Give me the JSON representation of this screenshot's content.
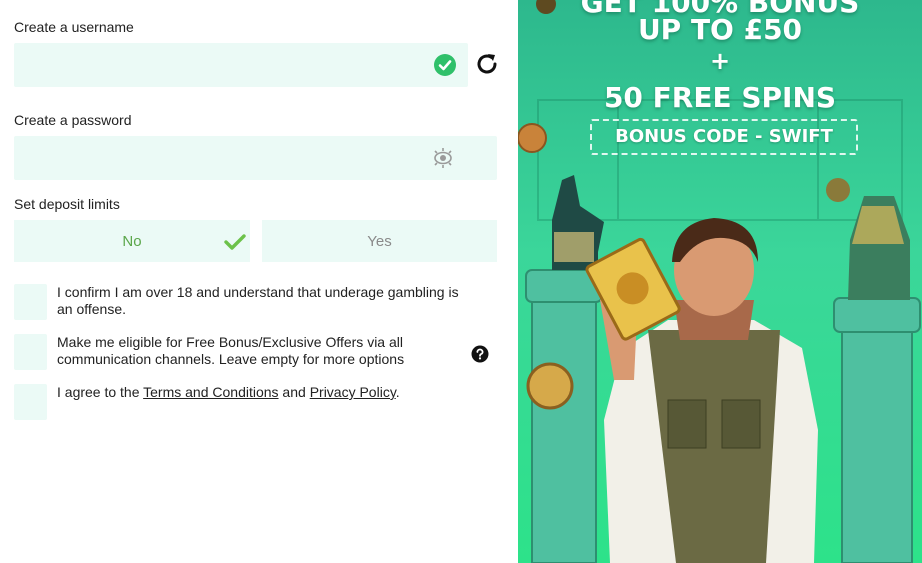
{
  "form": {
    "username_label": "Create a username",
    "password_label": "Create a password",
    "deposit_label": "Set deposit limits",
    "deposit_no": "No",
    "deposit_yes": "Yes",
    "age_confirm": "I confirm I am over 18 and understand that underage gambling is an offense.",
    "offers_optin": "Make me eligible for Free Bonus/Exclusive Offers via all communication channels. Leave empty for more options",
    "terms_prefix": "I agree to the ",
    "terms_link": "Terms and Conditions",
    "terms_and": " and ",
    "privacy_link": "Privacy Policy",
    "terms_suffix": "."
  },
  "promo": {
    "line1": "GET 100% BONUS",
    "line2": "UP TO £50",
    "line3": "+",
    "line4": "50 FREE SPINS",
    "bonus_code": "BONUS CODE - SWIFT"
  },
  "colors": {
    "field_bg": "#ebfaf6",
    "ok_green": "#2fc06a",
    "no_text": "#5aa64a",
    "promo_green": "#3bd69a"
  },
  "icons": {
    "username_status": "check-circle-icon",
    "password_toggle": "eye-icon",
    "regenerate": "refresh-icon",
    "selected_option": "checkmark-icon",
    "info": "question-circle-icon"
  }
}
